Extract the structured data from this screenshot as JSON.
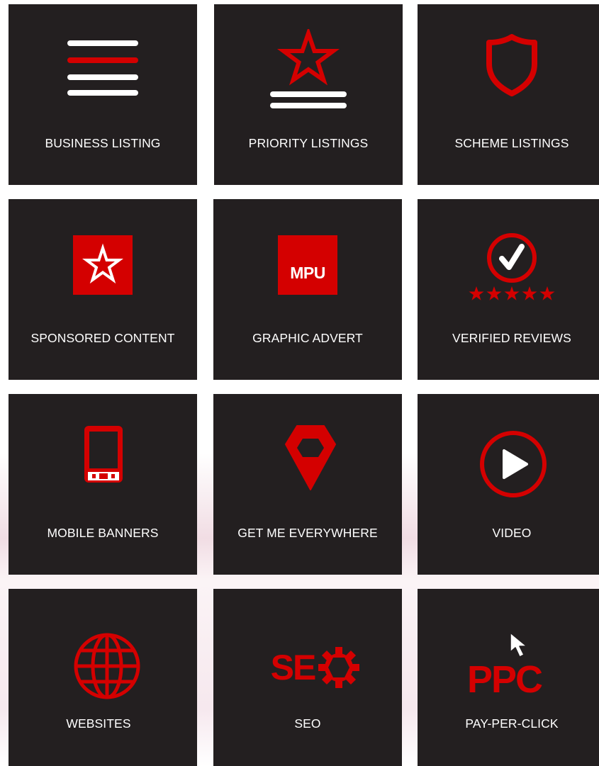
{
  "colors": {
    "tile_bg": "#231f20",
    "accent": "#d40000",
    "text": "#ffffff"
  },
  "tiles": [
    {
      "label": "BUSINESS LISTING",
      "icon": "list-lines-icon"
    },
    {
      "label": "PRIORITY LISTINGS",
      "icon": "star-over-lines-icon"
    },
    {
      "label": "SCHEME LISTINGS",
      "icon": "shield-icon"
    },
    {
      "label": "SPONSORED CONTENT",
      "icon": "star-square-icon"
    },
    {
      "label": "GRAPHIC ADVERT",
      "icon": "mpu-icon",
      "icon_text": "MPU"
    },
    {
      "label": "VERIFIED REVIEWS",
      "icon": "check-circle-stars-icon"
    },
    {
      "label": "MOBILE BANNERS",
      "icon": "mobile-phone-icon"
    },
    {
      "label": "GET ME EVERYWHERE",
      "icon": "map-pin-icon"
    },
    {
      "label": "VIDEO",
      "icon": "play-circle-icon"
    },
    {
      "label": "WEBSITES",
      "icon": "globe-icon"
    },
    {
      "label": "SEO",
      "icon": "seo-gear-icon",
      "icon_text": "SE"
    },
    {
      "label": "PAY-PER-CLICK",
      "icon": "ppc-cursor-icon",
      "icon_text": "PPC"
    }
  ]
}
